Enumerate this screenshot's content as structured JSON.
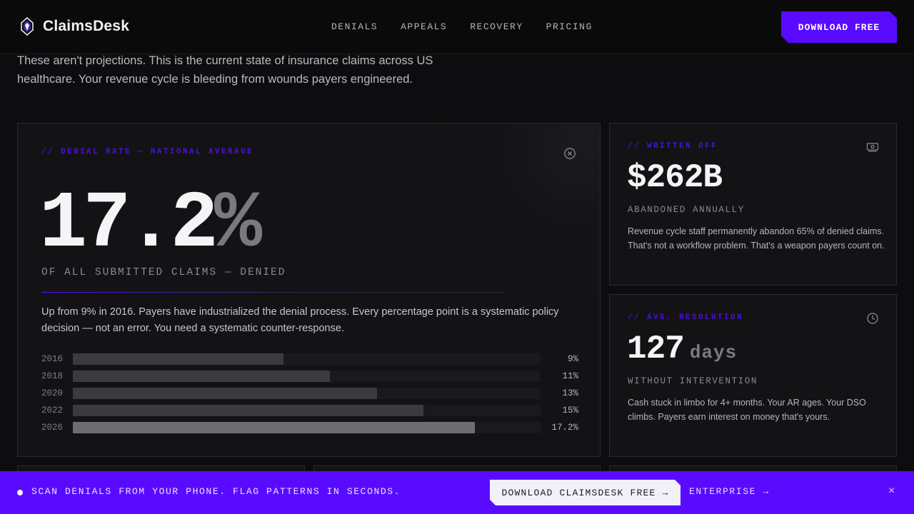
{
  "nav": {
    "brand": "ClaimsDesk",
    "links": [
      "DENIALS",
      "APPEALS",
      "RECOVERY",
      "PRICING"
    ],
    "cta": "DOWNLOAD FREE"
  },
  "intro": "These aren't projections. This is the current state of insurance claims across US healthcare. Your revenue cycle is bleeding from wounds payers engineered.",
  "denial": {
    "label": "// DENIAL RATE — NATIONAL AVERAGE",
    "value": "17.2",
    "unit": "%",
    "subtitle": "OF ALL SUBMITTED CLAIMS — DENIED",
    "description": "Up from 9% in 2016. Payers have industrialized the denial process. Every percentage point is a systematic policy decision — not an error. You need a systematic counter-response.",
    "trend": [
      {
        "year": "2016",
        "label": "9%",
        "value": 9
      },
      {
        "year": "2018",
        "label": "11%",
        "value": 11
      },
      {
        "year": "2020",
        "label": "13%",
        "value": 13
      },
      {
        "year": "2022",
        "label": "15%",
        "value": 15
      },
      {
        "year": "2026",
        "label": "17.2%",
        "value": 17.2
      }
    ],
    "trend_max": 20
  },
  "written_off": {
    "label": "// WRITTEN OFF",
    "value": "$262B",
    "subtitle": "ABANDONED ANNUALLY",
    "description": "Revenue cycle staff permanently abandon 65% of denied claims. That's not a workflow problem. That's a weapon payers count on."
  },
  "resolution": {
    "label": "// AVG. RESOLUTION",
    "value": "127",
    "unit": "days",
    "subtitle": "WITHOUT INTERVENTION",
    "description": "Cash stuck in limbo for 4+ months. Your AR ages. Your DSO climbs. Payers earn interest on money that's yours."
  },
  "banner": {
    "text": "SCAN DENIALS FROM YOUR PHONE. FLAG PATTERNS IN SECONDS.",
    "button": "DOWNLOAD CLAIMSDESK FREE →",
    "link": "ENTERPRISE →",
    "close": "×"
  },
  "colors": {
    "accent": "#5a0bff",
    "background": "#0d0d0f",
    "card": "#131315"
  }
}
